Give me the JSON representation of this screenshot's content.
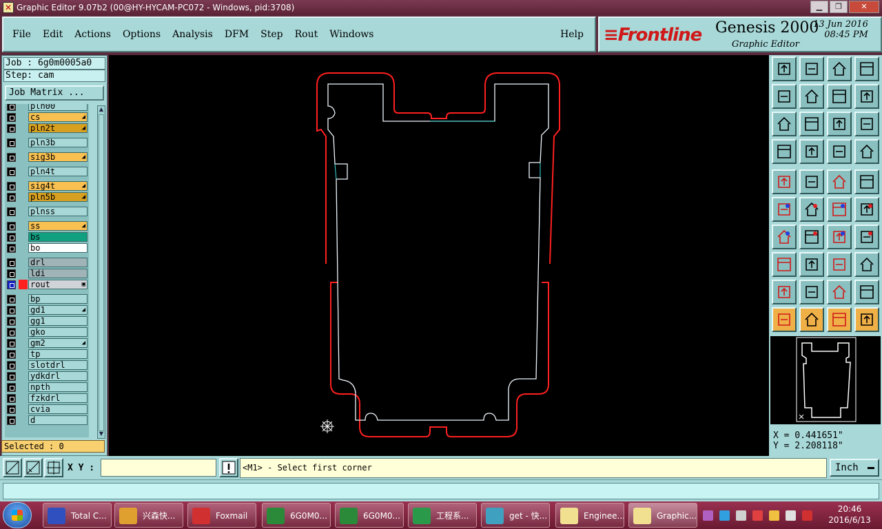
{
  "window": {
    "title": "Graphic Editor 9.07b2 (00@HY-HYCAM-PC072 - Windows, pid:3708)",
    "app_icon": "x-icon",
    "buttons": [
      "minimize",
      "maximize",
      "close"
    ]
  },
  "menu": {
    "file": "File",
    "edit": "Edit",
    "actions": "Actions",
    "options": "Options",
    "analysis": "Analysis",
    "dfm": "DFM",
    "step": "Step",
    "rout": "Rout",
    "windows": "Windows",
    "help": "Help"
  },
  "brand": {
    "logo": "Frontline",
    "product": "Genesis 2000",
    "subtitle": "Graphic Editor",
    "date": "13 Jun 2016",
    "time": "08:45 PM"
  },
  "job": {
    "job_line": "Job : 6g0m0005a0",
    "step_line": "Step: cam",
    "matrix_button": "Job Matrix ..."
  },
  "layers": [
    {
      "name": "pln00",
      "color": "#a8d8d8",
      "flag": ""
    },
    {
      "name": "cs",
      "color": "#f8c050",
      "flag": "◢"
    },
    {
      "name": "pln2t",
      "color": "#d8a020",
      "flag": "◢"
    },
    {
      "name": "pln3b",
      "color": "#a8d8d8",
      "flag": ""
    },
    {
      "name": "sig3b",
      "color": "#f8c050",
      "flag": "◢"
    },
    {
      "name": "pln4t",
      "color": "#a8d8d8",
      "flag": ""
    },
    {
      "name": "sig4t",
      "color": "#f8c050",
      "flag": "◢"
    },
    {
      "name": "pln5b",
      "color": "#d8a020",
      "flag": "◢"
    },
    {
      "name": "plnss",
      "color": "#a8d8d8",
      "flag": ""
    },
    {
      "name": "ss",
      "color": "#f8c050",
      "flag": "◢"
    },
    {
      "name": "bs",
      "color": "#10a080",
      "flag": ""
    },
    {
      "name": "bo",
      "color": "#ffffff",
      "flag": ""
    },
    {
      "name": "drl",
      "color": "#a0b4b8",
      "flag": ""
    },
    {
      "name": "ldi",
      "color": "#a0b4b8",
      "flag": ""
    },
    {
      "name": "rout",
      "color": "#d0d4d8",
      "flag": "▣"
    },
    {
      "name": "bp",
      "color": "#a8d8d8",
      "flag": ""
    },
    {
      "name": "gd1",
      "color": "#a8d8d8",
      "flag": "◢"
    },
    {
      "name": "gg1",
      "color": "#a8d8d8",
      "flag": ""
    },
    {
      "name": "gko",
      "color": "#a8d8d8",
      "flag": ""
    },
    {
      "name": "gm2",
      "color": "#a8d8d8",
      "flag": "◢"
    },
    {
      "name": "tp",
      "color": "#a8d8d8",
      "flag": ""
    },
    {
      "name": "slotdrl",
      "color": "#a8d8d8",
      "flag": ""
    },
    {
      "name": "ydkdrl",
      "color": "#a8d8d8",
      "flag": ""
    },
    {
      "name": "npth",
      "color": "#a8d8d8",
      "flag": ""
    },
    {
      "name": "fzkdrl",
      "color": "#a8d8d8",
      "flag": ""
    },
    {
      "name": "cvia",
      "color": "#a8d8d8",
      "flag": ""
    },
    {
      "name": "d",
      "color": "#a8d8d8",
      "flag": ""
    }
  ],
  "selected": "Selected : 0",
  "coords": {
    "x": "X = 0.441651\"",
    "y": "Y = 2.208118\""
  },
  "bottom": {
    "xy_label": "X Y :",
    "xy_value": "",
    "message": "<M1> - Select first corner",
    "units": "Inch"
  },
  "colors": {
    "panel": "#a8d8d8",
    "outline_red": "#ff2020",
    "profile": "#e8f8ff",
    "accent": "#f0b048"
  },
  "taskbar": {
    "items": [
      {
        "label": "Total C...",
        "icon": "floppy-icon"
      },
      {
        "label": "兴森快...",
        "icon": "shell-icon"
      },
      {
        "label": "Foxmail",
        "icon": "foxmail-icon"
      },
      {
        "label": "6G0M0...",
        "icon": "excel-icon"
      },
      {
        "label": "6G0M0...",
        "icon": "excel-icon"
      },
      {
        "label": "工程系...",
        "icon": "p-icon"
      },
      {
        "label": "get - 快...",
        "icon": "eye-icon"
      },
      {
        "label": "Enginee...",
        "icon": "x-icon"
      },
      {
        "label": "Graphic...",
        "icon": "x-icon"
      }
    ],
    "time": "20:46",
    "date": "2016/6/13"
  }
}
